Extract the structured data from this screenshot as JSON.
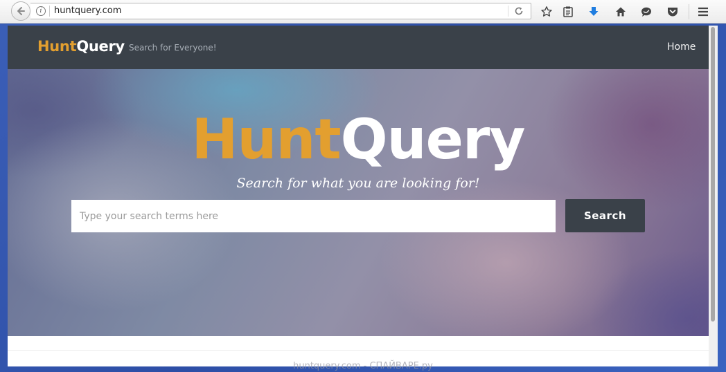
{
  "browser": {
    "url": "huntquery.com",
    "icons": [
      "back-arrow-icon",
      "info-icon",
      "reload-icon",
      "bookmark-star-icon",
      "reading-list-icon",
      "download-icon",
      "home-icon",
      "chat-icon",
      "pocket-icon",
      "hamburger-menu-icon"
    ],
    "accent_color": "#1f7de0"
  },
  "site": {
    "brand_hunt": "Hunt",
    "brand_query": "Query",
    "tagline": "Search for Everyone!",
    "nav_home": "Home",
    "nav_color": "#3a4149",
    "brand_color": "#e39f2f"
  },
  "hero": {
    "logo_hunt": "Hunt",
    "logo_query": "Query",
    "subtitle": "Search for what you are looking for!",
    "search_placeholder": "Type your search terms here",
    "search_value": "",
    "search_button": "Search"
  },
  "watermark": "huntquery.com - СПАЙВАРЕ.ру"
}
